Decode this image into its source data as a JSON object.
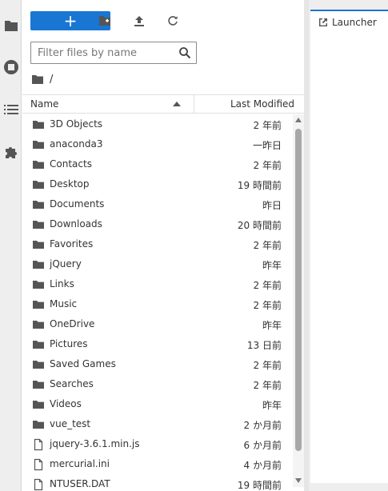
{
  "toolbar": {
    "new_label": "+",
    "icons": [
      "new-folder-icon",
      "upload-icon",
      "refresh-icon"
    ]
  },
  "filter": {
    "placeholder": "Filter files by name",
    "value": ""
  },
  "breadcrumb": {
    "path": "/"
  },
  "list_header": {
    "name": "Name",
    "modified": "Last Modified"
  },
  "files": [
    {
      "name": "3D Objects",
      "modified": "2 年前",
      "type": "folder"
    },
    {
      "name": "anaconda3",
      "modified": "一昨日",
      "type": "folder"
    },
    {
      "name": "Contacts",
      "modified": "2 年前",
      "type": "folder"
    },
    {
      "name": "Desktop",
      "modified": "19 時間前",
      "type": "folder"
    },
    {
      "name": "Documents",
      "modified": "昨日",
      "type": "folder"
    },
    {
      "name": "Downloads",
      "modified": "20 時間前",
      "type": "folder"
    },
    {
      "name": "Favorites",
      "modified": "2 年前",
      "type": "folder"
    },
    {
      "name": "jQuery",
      "modified": "昨年",
      "type": "folder"
    },
    {
      "name": "Links",
      "modified": "2 年前",
      "type": "folder"
    },
    {
      "name": "Music",
      "modified": "2 年前",
      "type": "folder"
    },
    {
      "name": "OneDrive",
      "modified": "昨年",
      "type": "folder"
    },
    {
      "name": "Pictures",
      "modified": "13 日前",
      "type": "folder"
    },
    {
      "name": "Saved Games",
      "modified": "2 年前",
      "type": "folder"
    },
    {
      "name": "Searches",
      "modified": "2 年前",
      "type": "folder"
    },
    {
      "name": "Videos",
      "modified": "昨年",
      "type": "folder"
    },
    {
      "name": "vue_test",
      "modified": "2 か月前",
      "type": "folder"
    },
    {
      "name": "jquery-3.6.1.min.js",
      "modified": "6 か月前",
      "type": "file"
    },
    {
      "name": "mercurial.ini",
      "modified": "4 か月前",
      "type": "file"
    },
    {
      "name": "NTUSER.DAT",
      "modified": "19 時間前",
      "type": "file"
    }
  ],
  "tab": {
    "label": "Launcher"
  },
  "colors": {
    "accent": "#1976d2",
    "icon": "#555555"
  }
}
